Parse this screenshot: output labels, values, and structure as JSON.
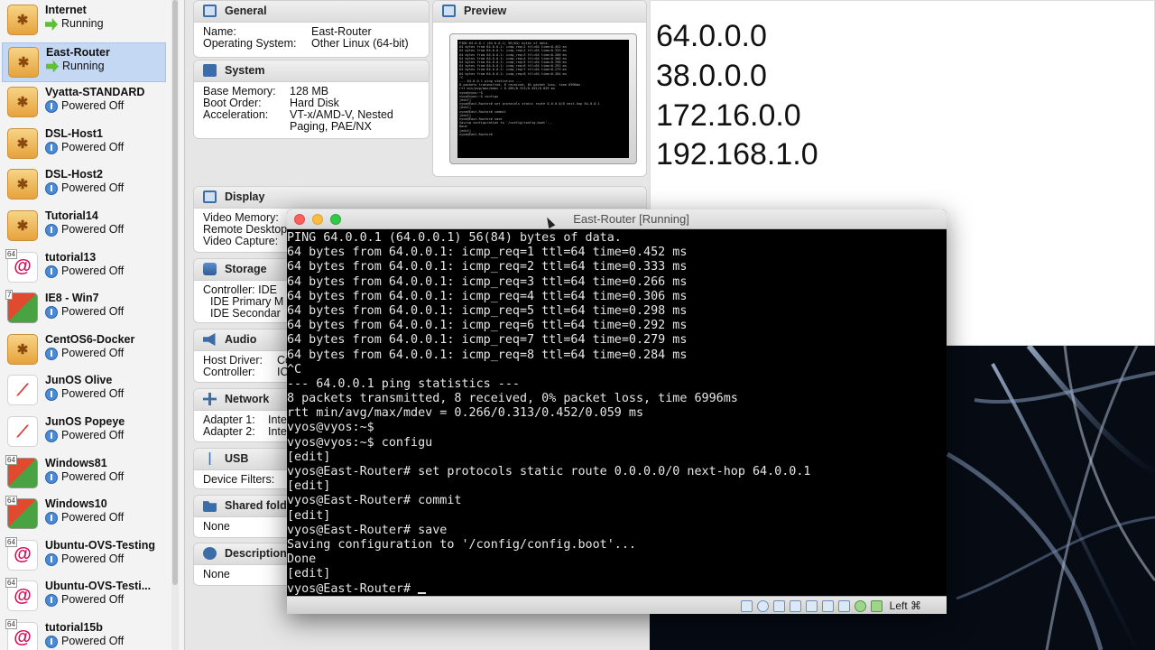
{
  "vm_list": [
    {
      "name": "Internet",
      "state": "Running",
      "os": "vyos",
      "badge": ""
    },
    {
      "name": "East-Router",
      "state": "Running",
      "os": "vyos",
      "badge": "",
      "selected": true
    },
    {
      "name": "Vyatta-STANDARD",
      "state": "Powered Off",
      "os": "vyos",
      "badge": ""
    },
    {
      "name": "DSL-Host1",
      "state": "Powered Off",
      "os": "vyos",
      "badge": ""
    },
    {
      "name": "DSL-Host2",
      "state": "Powered Off",
      "os": "vyos",
      "badge": ""
    },
    {
      "name": "Tutorial14",
      "state": "Powered Off",
      "os": "vyos",
      "badge": ""
    },
    {
      "name": "tutorial13",
      "state": "Powered Off",
      "os": "debian",
      "badge": "64"
    },
    {
      "name": "IE8 - Win7",
      "state": "Powered Off",
      "os": "win",
      "badge": "7"
    },
    {
      "name": "CentOS6-Docker",
      "state": "Powered Off",
      "os": "vyos",
      "badge": ""
    },
    {
      "name": "JunOS Olive",
      "state": "Powered Off",
      "os": "junos",
      "badge": ""
    },
    {
      "name": "JunOS Popeye",
      "state": "Powered Off",
      "os": "junos",
      "badge": ""
    },
    {
      "name": "Windows81",
      "state": "Powered Off",
      "os": "win",
      "badge": "64"
    },
    {
      "name": "Windows10",
      "state": "Powered Off",
      "os": "win",
      "badge": "64"
    },
    {
      "name": "Ubuntu-OVS-Testing",
      "state": "Powered Off",
      "os": "debian",
      "badge": "64"
    },
    {
      "name": "Ubuntu-OVS-Testi...",
      "state": "Powered Off",
      "os": "debian",
      "badge": "64"
    },
    {
      "name": "tutorial15b",
      "state": "Powered Off",
      "os": "debian",
      "badge": "64"
    }
  ],
  "details": {
    "general": {
      "title": "General",
      "name_label": "Name:",
      "name_value": "East-Router",
      "os_label": "Operating System:",
      "os_value": "Other Linux (64-bit)"
    },
    "preview": {
      "title": "Preview"
    },
    "system": {
      "title": "System",
      "mem_label": "Base Memory:",
      "mem_value": "128 MB",
      "boot_label": "Boot Order:",
      "boot_value": "Hard Disk",
      "accel_label": "Acceleration:",
      "accel_value_1": "VT-x/AMD-V, Nested",
      "accel_value_2": "Paging, PAE/NX"
    },
    "display": {
      "title": "Display",
      "video_mem_label": "Video Memory:",
      "remote_label": "Remote Desktop",
      "capture_label": "Video Capture:"
    },
    "storage": {
      "title": "Storage",
      "controller_label": "Controller: IDE",
      "ide_primary": "IDE Primary M",
      "ide_secondary": "IDE Secondar"
    },
    "audio": {
      "title": "Audio",
      "host_driver_label": "Host Driver:",
      "host_driver_value": "Co",
      "controller_label": "Controller:",
      "controller_value": "IC"
    },
    "network": {
      "title": "Network",
      "adapter1_label": "Adapter 1:",
      "adapter1_value": "Inte",
      "adapter2_label": "Adapter 2:",
      "adapter2_value": "Inte"
    },
    "usb": {
      "title": "USB",
      "filters_label": "Device Filters:"
    },
    "shared": {
      "title": "Shared fold",
      "value": "None"
    },
    "description": {
      "title": "Description",
      "value": "None"
    }
  },
  "networks": [
    "64.0.0.0",
    "38.0.0.0",
    "172.16.0.0",
    "192.168.1.0"
  ],
  "vm_window": {
    "title": "East-Router [Running]",
    "host_key": "Left ⌘",
    "terminal_lines": [
      "PING 64.0.0.1 (64.0.0.1) 56(84) bytes of data.",
      "64 bytes from 64.0.0.1: icmp_req=1 ttl=64 time=0.452 ms",
      "64 bytes from 64.0.0.1: icmp_req=2 ttl=64 time=0.333 ms",
      "64 bytes from 64.0.0.1: icmp_req=3 ttl=64 time=0.266 ms",
      "64 bytes from 64.0.0.1: icmp_req=4 ttl=64 time=0.306 ms",
      "64 bytes from 64.0.0.1: icmp_req=5 ttl=64 time=0.298 ms",
      "64 bytes from 64.0.0.1: icmp_req=6 ttl=64 time=0.292 ms",
      "64 bytes from 64.0.0.1: icmp_req=7 ttl=64 time=0.279 ms",
      "64 bytes from 64.0.0.1: icmp_req=8 ttl=64 time=0.284 ms",
      "^C",
      "--- 64.0.0.1 ping statistics ---",
      "8 packets transmitted, 8 received, 0% packet loss, time 6996ms",
      "rtt min/avg/max/mdev = 0.266/0.313/0.452/0.059 ms",
      "vyos@vyos:~$",
      "vyos@vyos:~$ configu",
      "[edit]",
      "vyos@East-Router# set protocols static route 0.0.0.0/0 next-hop 64.0.0.1",
      "[edit]",
      "vyos@East-Router# commit",
      "[edit]",
      "vyos@East-Router# save",
      "Saving configuration to '/config/config.boot'...",
      "Done",
      "[edit]",
      "vyos@East-Router# "
    ]
  }
}
